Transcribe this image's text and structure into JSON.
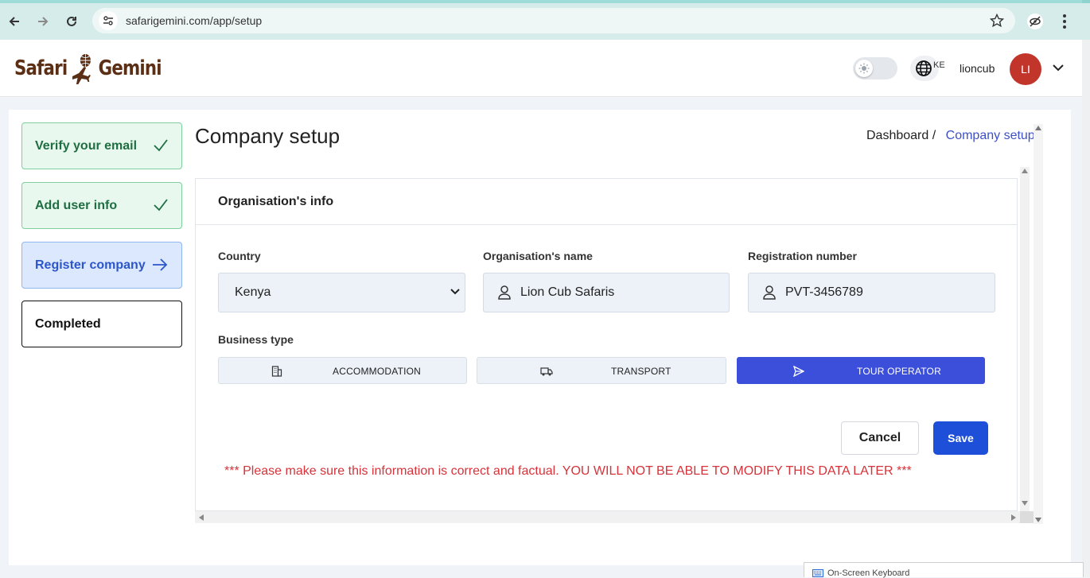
{
  "browser": {
    "url": "safarigemini.com/app/setup"
  },
  "header": {
    "logo_left": "Safari",
    "logo_right": "Gemini",
    "language_code": "KE",
    "username": "lioncub",
    "avatar_initials": "LI"
  },
  "steps": [
    {
      "label": "Verify your email",
      "state": "done",
      "icon": "check-icon"
    },
    {
      "label": "Add user info",
      "state": "done",
      "icon": "check-icon"
    },
    {
      "label": "Register company",
      "state": "active",
      "icon": "arrow-right-icon"
    },
    {
      "label": "Completed",
      "state": "pending"
    }
  ],
  "page": {
    "title": "Company setup",
    "breadcrumb": {
      "root": "Dashboard",
      "separator": "/",
      "current": "Company setup"
    }
  },
  "form": {
    "section_title": "Organisation's info",
    "country": {
      "label": "Country",
      "value": "Kenya"
    },
    "org_name": {
      "label": "Organisation's name",
      "value": "Lion Cub Safaris"
    },
    "reg_number": {
      "label": "Registration number",
      "value": "PVT-3456789"
    },
    "business_type": {
      "label": "Business type",
      "options": [
        {
          "label": "ACCOMMODATION",
          "icon": "building-icon",
          "selected": false
        },
        {
          "label": "TRANSPORT",
          "icon": "truck-icon",
          "selected": false
        },
        {
          "label": "TOUR OPERATOR",
          "icon": "paper-plane-icon",
          "selected": true
        }
      ]
    },
    "cancel_label": "Cancel",
    "save_label": "Save",
    "warning": "*** Please make sure this information is correct and factual. YOU WILL NOT BE ABLE TO MODIFY THIS DATA LATER ***"
  },
  "taskbar": {
    "osk_title": "On-Screen Keyboard"
  },
  "colors": {
    "brand_brown": "#5a2f15",
    "primary_blue": "#1e4fd8",
    "selected_blue": "#3c4fdb",
    "success_green": "#1f6e42",
    "warning_red": "#d6333a",
    "avatar_red": "#c2352a"
  }
}
